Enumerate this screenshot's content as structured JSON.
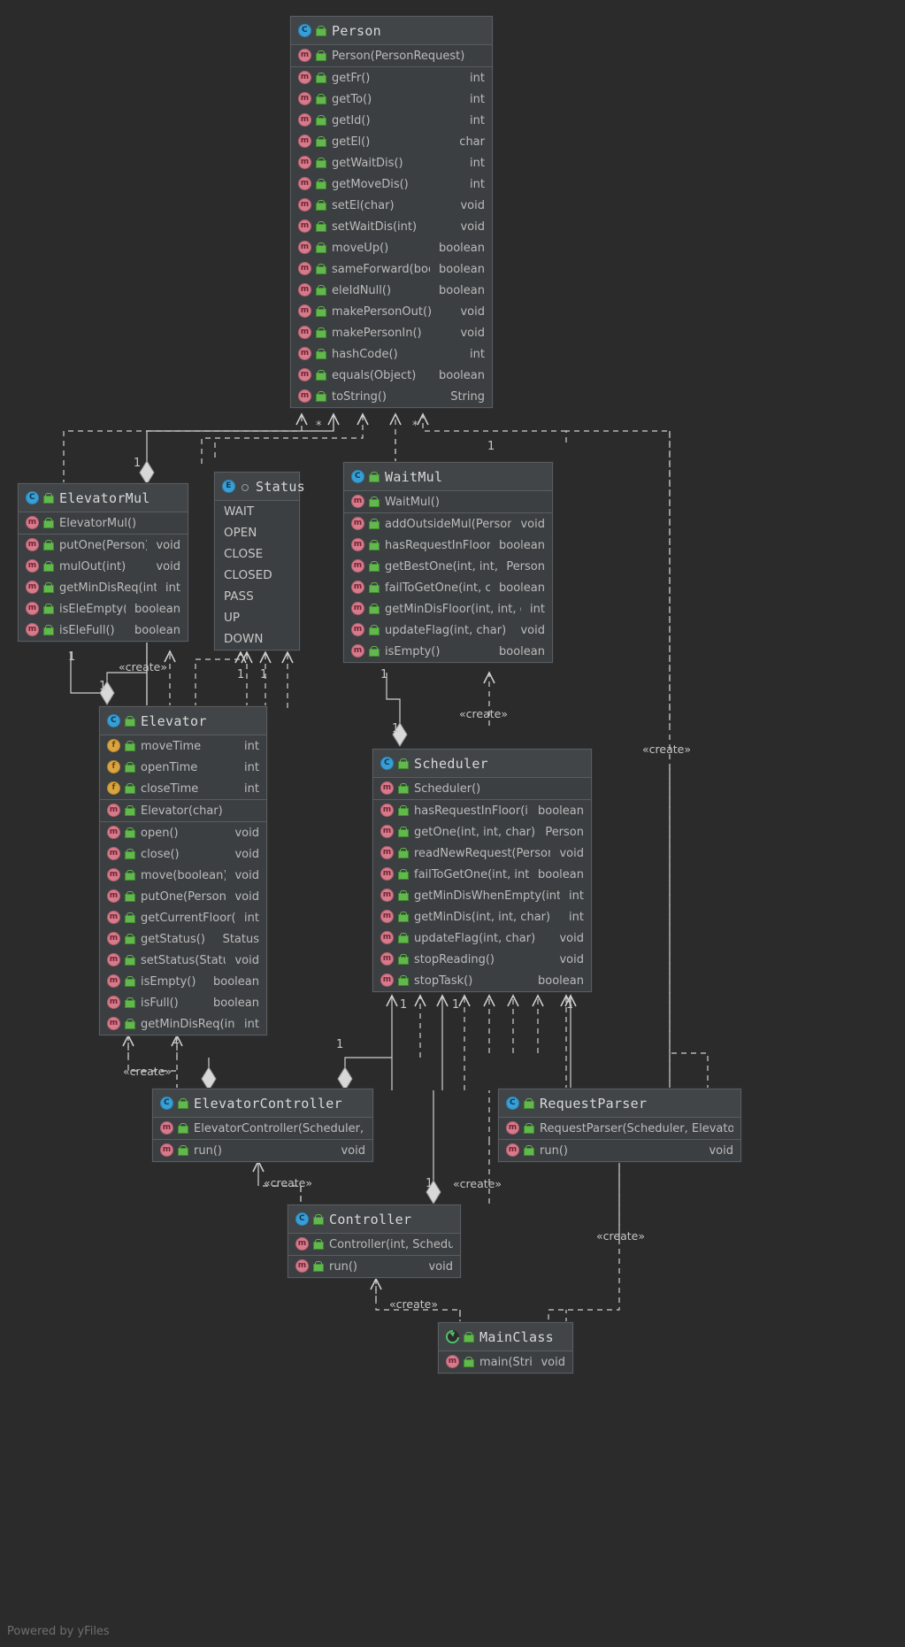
{
  "watermark": "Powered by yFiles",
  "icons": {
    "class": "class-icon",
    "enum": "enum-icon",
    "method": "method-icon",
    "field": "field-icon",
    "main": "runnable-main-icon",
    "visibility": "public-lock-icon"
  },
  "classes": {
    "person": {
      "name": "Person",
      "kind": "class",
      "constructors": [
        {
          "label": "Person(PersonRequest)",
          "type": ""
        }
      ],
      "members": [
        {
          "label": "getFr()",
          "type": "int"
        },
        {
          "label": "getTo()",
          "type": "int"
        },
        {
          "label": "getId()",
          "type": "int"
        },
        {
          "label": "getEl()",
          "type": "char"
        },
        {
          "label": "getWaitDis()",
          "type": "int"
        },
        {
          "label": "getMoveDis()",
          "type": "int"
        },
        {
          "label": "setEl(char)",
          "type": "void"
        },
        {
          "label": "setWaitDis(int)",
          "type": "void"
        },
        {
          "label": "moveUp()",
          "type": "boolean"
        },
        {
          "label": "sameForward(boolean)",
          "type": "boolean"
        },
        {
          "label": "eleIdNull()",
          "type": "boolean"
        },
        {
          "label": "makePersonOut()",
          "type": "void"
        },
        {
          "label": "makePersonIn()",
          "type": "void"
        },
        {
          "label": "hashCode()",
          "type": "int"
        },
        {
          "label": "equals(Object)",
          "type": "boolean"
        },
        {
          "label": "toString()",
          "type": "String"
        }
      ]
    },
    "elevatorMul": {
      "name": "ElevatorMul",
      "kind": "class",
      "constructors": [
        {
          "label": "ElevatorMul()",
          "type": ""
        }
      ],
      "members": [
        {
          "label": "putOne(Person)",
          "type": "void"
        },
        {
          "label": "mulOut(int)",
          "type": "void"
        },
        {
          "label": "getMinDisReq(int, int)",
          "type": "int"
        },
        {
          "label": "isEleEmpty()",
          "type": "boolean"
        },
        {
          "label": "isEleFull()",
          "type": "boolean"
        }
      ]
    },
    "status": {
      "name": "Status",
      "kind": "enum",
      "values": [
        "WAIT",
        "OPEN",
        "CLOSE",
        "CLOSED",
        "PASS",
        "UP",
        "DOWN"
      ]
    },
    "waitMul": {
      "name": "WaitMul",
      "kind": "class",
      "constructors": [
        {
          "label": "WaitMul()",
          "type": ""
        }
      ],
      "members": [
        {
          "label": "addOutsideMul(Person)",
          "type": "void"
        },
        {
          "label": "hasRequestInFloor(int)",
          "type": "boolean"
        },
        {
          "label": "getBestOne(int, int, char)",
          "type": "Person"
        },
        {
          "label": "failToGetOne(int, char)",
          "type": "boolean"
        },
        {
          "label": "getMinDisFloor(int, int, char)",
          "type": "int"
        },
        {
          "label": "updateFlag(int, char)",
          "type": "void"
        },
        {
          "label": "isEmpty()",
          "type": "boolean"
        }
      ]
    },
    "elevator": {
      "name": "Elevator",
      "kind": "class",
      "fields": [
        {
          "label": "moveTime",
          "type": "int"
        },
        {
          "label": "openTime",
          "type": "int"
        },
        {
          "label": "closeTime",
          "type": "int"
        }
      ],
      "constructors": [
        {
          "label": "Elevator(char)",
          "type": ""
        }
      ],
      "members": [
        {
          "label": "open()",
          "type": "void"
        },
        {
          "label": "close()",
          "type": "void"
        },
        {
          "label": "move(boolean)",
          "type": "void"
        },
        {
          "label": "putOne(Person)",
          "type": "void"
        },
        {
          "label": "getCurrentFloor()",
          "type": "int"
        },
        {
          "label": "getStatus()",
          "type": "Status"
        },
        {
          "label": "setStatus(Status)",
          "type": "void"
        },
        {
          "label": "isEmpty()",
          "type": "boolean"
        },
        {
          "label": "isFull()",
          "type": "boolean"
        },
        {
          "label": "getMinDisReq(int, int)",
          "type": "int"
        }
      ]
    },
    "scheduler": {
      "name": "Scheduler",
      "kind": "class",
      "constructors": [
        {
          "label": "Scheduler()",
          "type": ""
        }
      ],
      "members": [
        {
          "label": "hasRequestInFloor(int)",
          "type": "boolean"
        },
        {
          "label": "getOne(int, int, char)",
          "type": "Person"
        },
        {
          "label": "readNewRequest(Person)",
          "type": "void"
        },
        {
          "label": "failToGetOne(int, int, char)",
          "type": "boolean"
        },
        {
          "label": "getMinDisWhenEmpty(int, char)",
          "type": "int"
        },
        {
          "label": "getMinDis(int, int, char)",
          "type": "int"
        },
        {
          "label": "updateFlag(int, char)",
          "type": "void"
        },
        {
          "label": "stopReading()",
          "type": "void"
        },
        {
          "label": "stopTask()",
          "type": "boolean"
        }
      ]
    },
    "elevatorController": {
      "name": "ElevatorController",
      "kind": "class",
      "constructors": [
        {
          "label": "ElevatorController(Scheduler, char)",
          "type": ""
        }
      ],
      "members": [
        {
          "label": "run()",
          "type": "void"
        }
      ]
    },
    "requestParser": {
      "name": "RequestParser",
      "kind": "class",
      "constructors": [
        {
          "label": "RequestParser(Scheduler, ElevatorInput)",
          "type": ""
        }
      ],
      "members": [
        {
          "label": "run()",
          "type": "void"
        }
      ]
    },
    "controller": {
      "name": "Controller",
      "kind": "class",
      "constructors": [
        {
          "label": "Controller(int, Scheduler)",
          "type": ""
        }
      ],
      "members": [
        {
          "label": "run()",
          "type": "void"
        }
      ]
    },
    "mainClass": {
      "name": "MainClass",
      "kind": "main",
      "members": [
        {
          "label": "main(String[])",
          "type": "void"
        }
      ]
    }
  },
  "edge_labels": {
    "create": "«create»",
    "one": "1",
    "star": "*"
  }
}
